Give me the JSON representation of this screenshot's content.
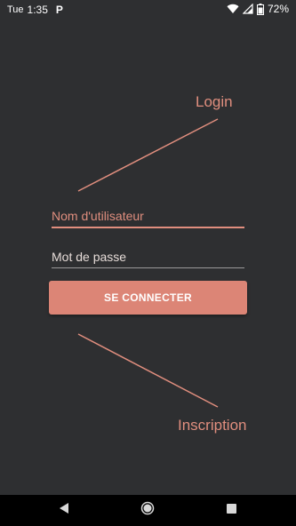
{
  "status_bar": {
    "day": "Tue",
    "time": "1:35",
    "notification_icon": "P",
    "battery_percent": "72%",
    "icons": [
      "wifi-icon",
      "signal-icon",
      "battery-icon"
    ]
  },
  "header": {
    "login_label": "Login"
  },
  "form": {
    "username_placeholder": "Nom d'utilisateur",
    "password_placeholder": "Mot de passe",
    "submit_label": "SE CONNECTER"
  },
  "footer": {
    "signup_label": "Inscription"
  },
  "nav_bar": {
    "icons": [
      "back-icon",
      "home-icon",
      "recents-icon"
    ]
  },
  "colors": {
    "background": "#2e2f31",
    "accent": "#e08e7e",
    "button": "#dc8576",
    "nav_bar": "#000000"
  }
}
